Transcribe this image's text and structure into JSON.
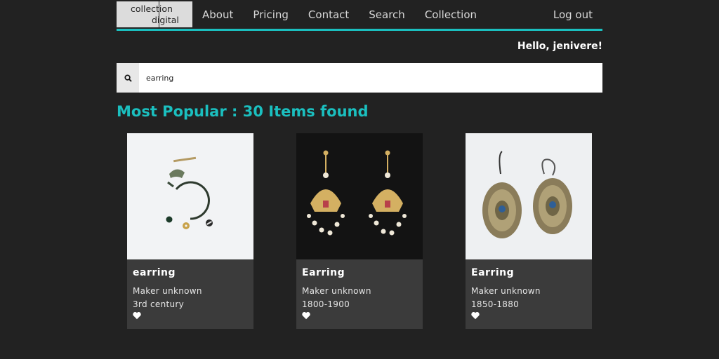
{
  "logo": {
    "line1": "collection",
    "line2": "digital"
  },
  "nav": {
    "links": [
      "About",
      "Pricing",
      "Contact",
      "Search",
      "Collection"
    ],
    "logout": "Log out"
  },
  "greeting": "Hello, jenivere!",
  "search": {
    "value": "earring"
  },
  "results_heading": "Most Popular : 30 Items found",
  "cards": [
    {
      "title": "earring",
      "maker": "Maker unknown",
      "date": "3rd century"
    },
    {
      "title": "Earring",
      "maker": "Maker unknown",
      "date": "1800-1900"
    },
    {
      "title": "Earring",
      "maker": "Maker unknown",
      "date": "1850-1880"
    }
  ],
  "colors": {
    "accent": "#1bbfbf",
    "background": "#222222",
    "card": "#3b3b3b"
  },
  "icons": {
    "search": "search-icon",
    "favorite": "heart-icon"
  }
}
